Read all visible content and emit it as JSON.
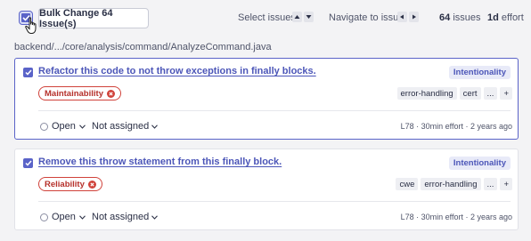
{
  "toolbar": {
    "bulk_button": "Bulk Change 64 Issue(s)",
    "select_issues": "Select issues",
    "navigate_to_issue": "Navigate to issue",
    "issues_count": "64",
    "issues_label": "issues",
    "effort_value": "1d",
    "effort_label": "effort"
  },
  "file_path": "backend/.../core/analysis/command/AnalyzeCommand.java",
  "issues": [
    {
      "title": "Refactor this code to not throw exceptions in finally blocks.",
      "attribute": "Intentionality",
      "quality": "Maintainability",
      "tags": [
        "error-handling",
        "cert",
        "...",
        "+"
      ],
      "status": "Open",
      "assignee": "Not assigned",
      "line": "L78",
      "effort": "30min effort",
      "age": "2 years ago"
    },
    {
      "title": "Remove this throw statement from this finally block.",
      "attribute": "Intentionality",
      "quality": "Reliability",
      "tags": [
        "cwe",
        "error-handling",
        "...",
        "+"
      ],
      "status": "Open",
      "assignee": "Not assigned",
      "line": "L78",
      "effort": "30min effort",
      "age": "2 years ago"
    }
  ],
  "colors": {
    "accent": "#5a63c8",
    "link": "#4c56b8",
    "severity_high": "#d0423a"
  },
  "icons": [
    "checkbox-checked-icon",
    "hand-cursor-icon",
    "arrow-up-icon",
    "arrow-down-icon",
    "arrow-left-icon",
    "arrow-right-icon",
    "severity-high-icon",
    "chevron-down-icon",
    "radio-icon"
  ]
}
